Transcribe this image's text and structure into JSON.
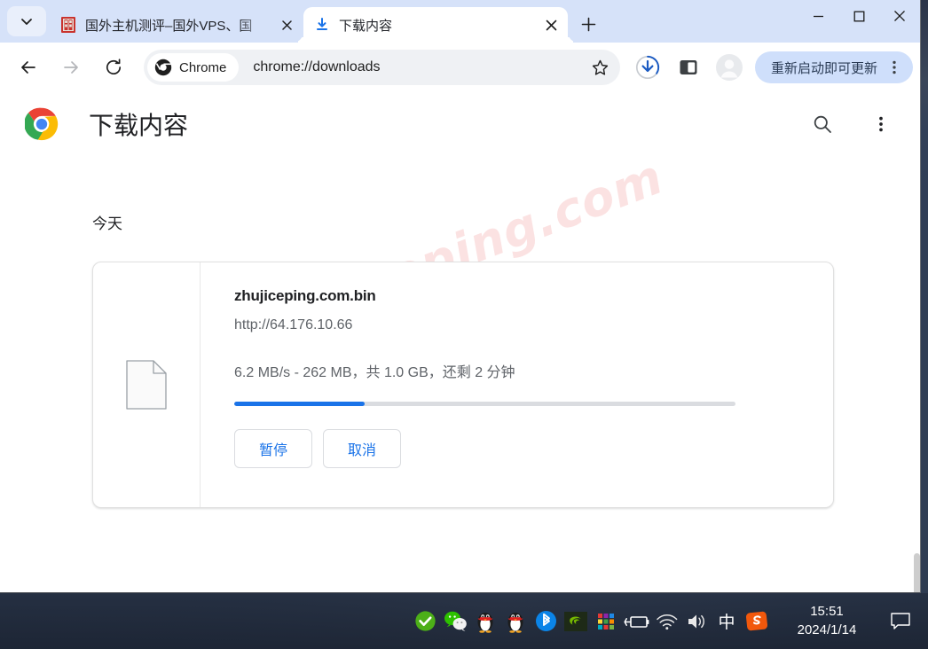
{
  "window": {
    "tabs": [
      {
        "title": "国外主机测评–国外VPS、国",
        "active": false,
        "favicon": "site-favicon"
      },
      {
        "title": "下载内容",
        "active": true,
        "favicon": "download-favicon"
      }
    ],
    "controls": {
      "tab_search": "tab-search-icon",
      "new_tab": "new-tab-icon",
      "minimize": "minimize-icon",
      "maximize": "maximize-icon",
      "close": "close-icon"
    }
  },
  "toolbar": {
    "back": "back-arrow-icon",
    "forward": "forward-arrow-icon",
    "reload": "reload-icon",
    "chrome_chip_label": "Chrome",
    "url": "chrome://downloads",
    "bookmark": "star-icon",
    "downloads": "downloads-icon",
    "side_panel": "side-panel-icon",
    "profile": "profile-avatar-icon",
    "update_label": "重新启动即可更新",
    "menu": "kebab-menu-icon"
  },
  "page": {
    "title": "下载内容",
    "logo": "chrome-logo-icon",
    "search": "search-icon",
    "more": "more-vertical-icon",
    "watermark": "zhujiceping.com",
    "date_heading": "今天",
    "download": {
      "file_icon": "generic-file-icon",
      "file_name": "zhujiceping.com.bin",
      "url": "http://64.176.10.66",
      "status": "6.2 MB/s - 262 MB，共 1.0 GB，还剩 2 分钟",
      "progress_percent": 26,
      "pause_label": "暂停",
      "cancel_label": "取消"
    }
  },
  "taskbar": {
    "tray_icons": [
      "green-check-icon",
      "wechat-icon",
      "qq-penguin-icon",
      "qq-penguin-2-icon",
      "bluetooth-icon",
      "nvidia-icon",
      "color-grid-icon",
      "battery-charging-icon",
      "wifi-icon",
      "volume-icon"
    ],
    "ime_label": "中",
    "sogou_icon": "sogou-input-icon",
    "time": "15:51",
    "date": "2024/1/14",
    "notification": "notification-icon"
  },
  "colors": {
    "accent_blue": "#1a73e8",
    "tabstrip_bg": "#d6e2f9",
    "update_chip_bg": "#cfdffb",
    "watermark_pink": "#fbe2e2"
  }
}
